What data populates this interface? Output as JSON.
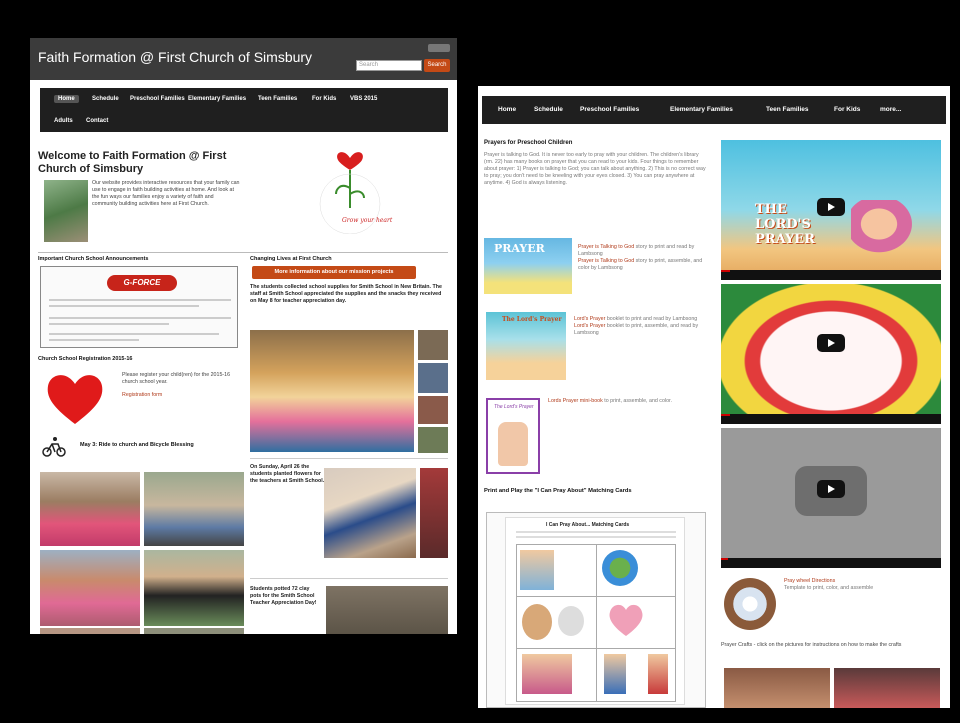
{
  "left": {
    "site_title": "Faith Formation @ First Church of Simsbury",
    "search_placeholder": "Search",
    "search_button": "Search",
    "nav": [
      "Home",
      "Schedule",
      "Preschool Families",
      "Elementary Families",
      "Teen Families",
      "For Kids",
      "VBS 2015",
      "Adults",
      "Contact"
    ],
    "welcome_title": "Welcome to Faith Formation @ First Church of Simsbury",
    "welcome_text": "Our website provides interactive resources that your family can use to engage in faith building activities at home. And look at the fun ways our families enjoy a variety of faith and community building activities here at First Church.",
    "logo_text": "Grow your heart",
    "announcements_heading": "Important Church School Announcements",
    "gforce_label": "G-FORCE",
    "registration_heading": "Church School Registration 2015-16",
    "registration_text": "Please register your child(ren) for the 2015-16 church school year.",
    "registration_link": "Registration form",
    "ride_text": "May 3: Ride to church and Bicycle Blessing",
    "changing_lives_heading": "Changing Lives at First Church",
    "mission_button": "More information about our mission projects",
    "mission_text": "The students collected school supplies for Smith School in New Britain. The staff at Smith School appreciated the supplies and the snacks they received on May 8 for teacher appreciation day.",
    "sunday_text": "On Sunday, April 26 the students planted flowers for the teachers at Smith School.",
    "potted_text": "Students potted 72 clay pots for the Smith School Teacher Appreciation Day!"
  },
  "right": {
    "nav": [
      "Home",
      "Schedule",
      "Preschool Families",
      "Elementary Families",
      "Teen Families",
      "For Kids",
      "more..."
    ],
    "prayers_heading": "Prayers for Preschool Children",
    "prayers_text": "Prayer is talking to God. It is never too early to pray with your children. The children's library (rm. 22) has many books on prayer that you can read to your kids. Four things to remember about prayer: 1) Prayer is talking to God; you can talk about anything. 2) This is no correct way to pray; you don't need to be kneeling with your eyes closed. 3) You can pray anywhere at anytime. 4) God is always listening.",
    "book1_label": "PRAYER",
    "book1_link1": "Prayer is Talking to God",
    "book1_text1": "story to print and read by Lambsong",
    "book1_link2": "Prayer is Talking to God",
    "book1_text2": "story to print, assemble, and color by Lambsong",
    "book2_label": "The Lord's Prayer",
    "book2_link1": "Lord's Prayer",
    "book2_text1": "booklet to print and read by Lambsong",
    "book2_link2": "Lord's Prayer",
    "book2_text2": "booklet to print, assemble, and read by Lambsong",
    "book3_label": "The Lord's Prayer",
    "book3_link": "Lords Prayer mini-book",
    "book3_text": "to print, assemble, and color.",
    "cards_heading": "Print and Play the \"I Can Pray About\" Matching Cards",
    "cards_title": "I Can Pray About... Matching Cards",
    "video1_title": "THE LORD'S PRAYER",
    "wheel_link": "Pray wheel Directions",
    "wheel_text": "Template to print, color, and assemble",
    "crafts_text": "Prayer Crafts - click on the pictures for instructions on how to make the crafts"
  },
  "colors": {
    "accent": "#c44a16",
    "link": "#b03a1a",
    "nav": "#1f1f1f"
  }
}
